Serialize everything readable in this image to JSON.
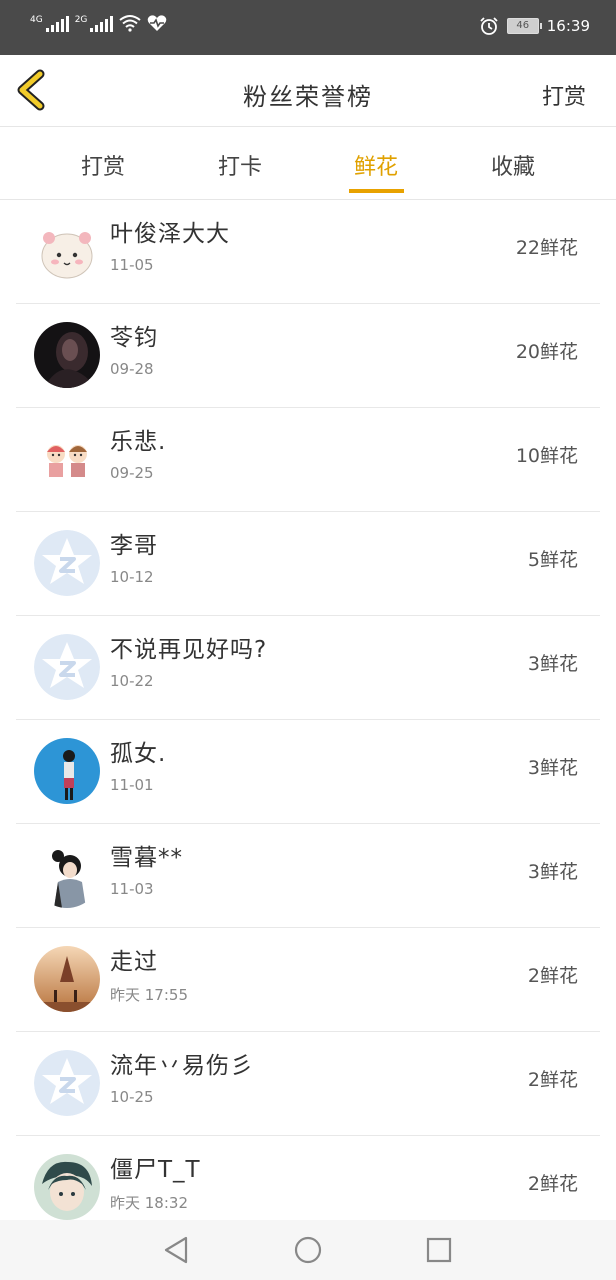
{
  "status_bar": {
    "net1": "4G",
    "net2": "2G",
    "battery": "46",
    "time": "16:39"
  },
  "header": {
    "title": "粉丝荣誉榜",
    "right_action": "打赏",
    "back_icon": "chevron-left-icon",
    "accent_color": "#e8a200"
  },
  "tabs": [
    {
      "label": "打赏"
    },
    {
      "label": "打卡"
    },
    {
      "label": "鲜花",
      "active": true
    },
    {
      "label": "收藏"
    }
  ],
  "list": [
    {
      "name": "叶俊泽大大",
      "date": "11-05",
      "count": "22鲜花",
      "avatar": "cartoon-bear"
    },
    {
      "name": "苓钧",
      "date": "09-28",
      "count": "20鲜花",
      "avatar": "dark-photo"
    },
    {
      "name": "乐悲.",
      "date": "09-25",
      "count": "10鲜花",
      "avatar": "cartoon-couple"
    },
    {
      "name": "李哥",
      "date": "10-12",
      "count": "5鲜花",
      "avatar": "default-star"
    },
    {
      "name": "不说再见好吗?",
      "date": "10-22",
      "count": "3鲜花",
      "avatar": "default-star"
    },
    {
      "name": "孤女.",
      "date": "11-01",
      "count": "3鲜花",
      "avatar": "blue-wall-photo"
    },
    {
      "name": "雪暮**",
      "date": "11-03",
      "count": "3鲜花",
      "avatar": "cartoon-girl"
    },
    {
      "name": "走过",
      "date": "昨天 17:55",
      "count": "2鲜花",
      "avatar": "sunset-photo"
    },
    {
      "name": "流年丷易伤彡",
      "date": "10-25",
      "count": "2鲜花",
      "avatar": "default-star"
    },
    {
      "name": "僵尸T_T",
      "date": "昨天 18:32",
      "count": "2鲜花",
      "avatar": "anime-boy"
    }
  ],
  "nav_bar": {
    "back": "triangle-back-icon",
    "home": "circle-home-icon",
    "recent": "square-recents-icon"
  }
}
